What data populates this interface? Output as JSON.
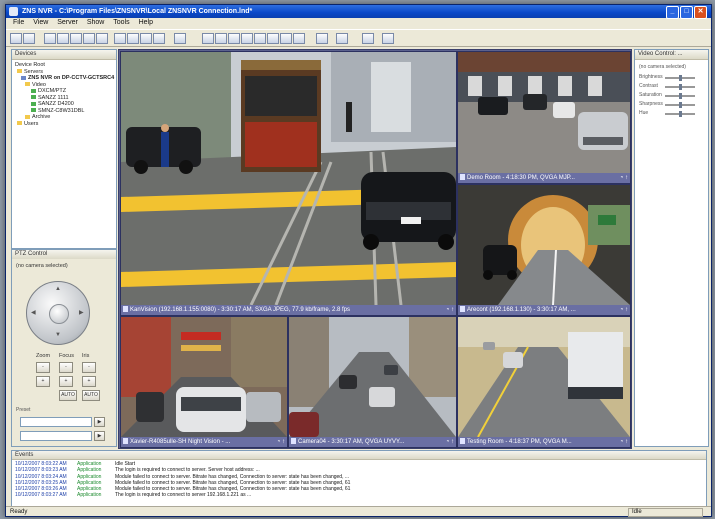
{
  "window": {
    "title": "ZNS NVR - C:\\Program Files\\ZNSNVR\\Local ZNSNVR Connection.lnd*",
    "minimize": "_",
    "maximize": "□",
    "close": "✕"
  },
  "menu": [
    "File",
    "View",
    "Server",
    "Show",
    "Tools",
    "Help"
  ],
  "devices_panel": {
    "title": "Devices",
    "device_root": "Device Root",
    "tree": [
      "Servers",
      "ZNS NVR on DP-CCTV-GCTSRC4",
      "Video",
      "DXCM/PTZ",
      "SANZZ 1111",
      "SANZZ D4200",
      "SMNZ-C8W31DBL",
      "Archive",
      "Users"
    ]
  },
  "ptz_panel": {
    "title": "PTZ Control",
    "subtitle": "(no camera selected)",
    "labels": [
      "Zoom",
      "Focus",
      "Iris"
    ],
    "buttons": [
      "-",
      "+",
      "AUTO",
      "AUTO"
    ],
    "preset_label": "Preset"
  },
  "video_panel": {
    "title": "Video Control: ...",
    "subtitle": "(no camera selected)",
    "rows": [
      "Brightness",
      "Contrast",
      "Saturation",
      "Sharpness",
      "Hue"
    ]
  },
  "cameras": [
    {
      "caption": "KanVision (192.168.1.155:0080) - 3:30:17 AM, SXGA JPEG, 77.9 kb/frame, 2.8 fps",
      "icons": "◔ ↑"
    },
    {
      "caption": "Demo Room - 4:18:30 PM, QVGA MJP...",
      "icons": "◔ ↑"
    },
    {
      "caption": "Arecont (192.168.1.130) - 3:30:17 AM, ...",
      "icons": "◔ ↑"
    },
    {
      "caption": "Xavier-R4085ulle-SH Night Vision - ...",
      "icons": "◔ ↑"
    },
    {
      "caption": "Camera04 - 3:30:17 AM, QVGA UYVY...",
      "icons": "◔ ↑"
    },
    {
      "caption": "Testing Room - 4:18:37 PM, QVGA M...",
      "icons": "◔ ↑"
    }
  ],
  "log": {
    "title": "Events",
    "rows": [
      {
        "time": "10/12/2007 8:03:22 AM",
        "source": "Application",
        "msg": "Idle Start"
      },
      {
        "time": "10/12/2007 8:03:23 AM",
        "source": "Application",
        "msg": "The login is required to connect to server. Server host address: ..."
      },
      {
        "time": "10/12/2007 8:03:24 AM",
        "source": "Application",
        "msg": "Module failed to connect to server. Bitrate has changed, Connection to server: state has been changed, ..."
      },
      {
        "time": "10/12/2007 8:03:25 AM",
        "source": "Application",
        "msg": "Module failed to connect to server. Bitrate has changed, Connection to server: state has been changed, 61"
      },
      {
        "time": "10/12/2007 8:03:26 AM",
        "source": "Application",
        "msg": "Module failed to connect to server. Bitrate has changed, Connection to server: state has been changed, 61"
      },
      {
        "time": "10/12/2007 8:03:27 AM",
        "source": "Application",
        "msg": "The login is required to connect to server 192.168.1.221 as ..."
      }
    ]
  },
  "statusbar": {
    "left": "Ready",
    "right": "Idle"
  },
  "colors": {
    "title_bar": "#0a48c8",
    "mosaic_border": "#5b618e",
    "caption_bg": "#6a6fa3",
    "chrome": "#ece9d8"
  }
}
